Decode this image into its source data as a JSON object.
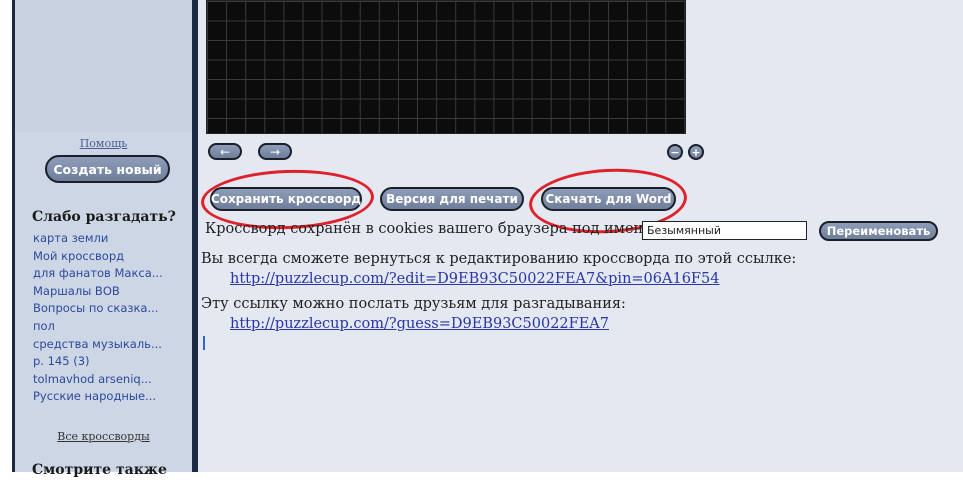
{
  "sidebar": {
    "help_link": "Помощь",
    "create_button": "Создать новый",
    "heading_weak": "Слабо разгадать?",
    "crosswords": [
      "карта земли",
      "Мой кроссворд",
      "для фанатов Макса...",
      "Маршалы ВОВ",
      "Вопросы по сказка...",
      "пол",
      "средства музыкаль...",
      "р. 145 (3)",
      "tolmavhod arseniq...",
      "Русские народные..."
    ],
    "all_crosswords_link": "Все кроссворды",
    "heading_see_also": "Смотрите также"
  },
  "toolbar": {
    "prev_label": "←",
    "next_label": "→",
    "zoom_out_label": "−",
    "zoom_in_label": "+",
    "save_label": "Сохранить кроссворд",
    "print_label": "Версия для печати",
    "word_label": "Скачать для Word",
    "rename_label": "Переименовать"
  },
  "status": {
    "saved_text": "Кроссворд сохранён в cookies вашего браузера под именем",
    "name_value": "Безымянный",
    "edit_info": "Вы всегда сможете вернуться к редактированию кроссворда по этой ссылке:",
    "edit_url": "http://puzzlecup.com/?edit=D9EB93C50022FEA7&pin=06A16F54",
    "share_info": "Эту ссылку можно послать друзьям для разгадывания:",
    "share_url": "http://puzzlecup.com/?guess=D9EB93C50022FEA7"
  },
  "colors": {
    "button_fill": "#7f8eab",
    "annotation_red": "#e0202a",
    "link_blue": "#2a35a6",
    "sidebar_bg": "#cdd6e4",
    "main_bg": "#e3e8f1"
  }
}
